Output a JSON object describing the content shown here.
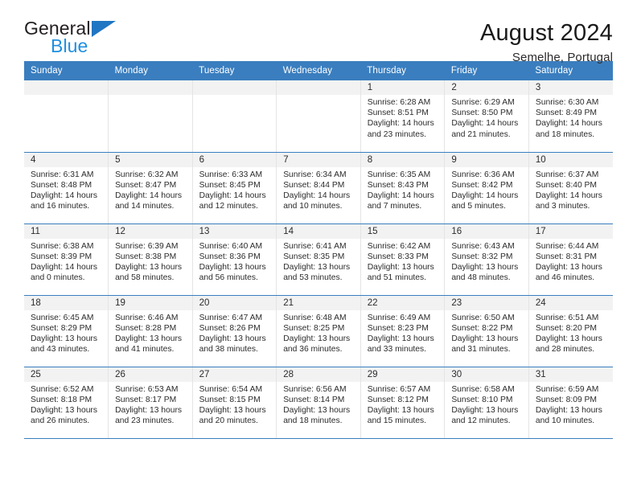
{
  "brand": {
    "name_part1": "General",
    "name_part2": "Blue",
    "accent_color": "#1f8fe0",
    "triangle_color": "#1f76c2"
  },
  "header": {
    "title": "August 2024",
    "subtitle": "Semelhe, Portugal"
  },
  "calendar": {
    "header_bg": "#3a7ebf",
    "daynum_bg": "#f2f2f2",
    "weekday_headers": [
      "Sunday",
      "Monday",
      "Tuesday",
      "Wednesday",
      "Thursday",
      "Friday",
      "Saturday"
    ],
    "weeks": [
      [
        {
          "day": "",
          "lines": []
        },
        {
          "day": "",
          "lines": []
        },
        {
          "day": "",
          "lines": []
        },
        {
          "day": "",
          "lines": []
        },
        {
          "day": "1",
          "lines": [
            "Sunrise: 6:28 AM",
            "Sunset: 8:51 PM",
            "Daylight: 14 hours",
            "and 23 minutes."
          ]
        },
        {
          "day": "2",
          "lines": [
            "Sunrise: 6:29 AM",
            "Sunset: 8:50 PM",
            "Daylight: 14 hours",
            "and 21 minutes."
          ]
        },
        {
          "day": "3",
          "lines": [
            "Sunrise: 6:30 AM",
            "Sunset: 8:49 PM",
            "Daylight: 14 hours",
            "and 18 minutes."
          ]
        }
      ],
      [
        {
          "day": "4",
          "lines": [
            "Sunrise: 6:31 AM",
            "Sunset: 8:48 PM",
            "Daylight: 14 hours",
            "and 16 minutes."
          ]
        },
        {
          "day": "5",
          "lines": [
            "Sunrise: 6:32 AM",
            "Sunset: 8:47 PM",
            "Daylight: 14 hours",
            "and 14 minutes."
          ]
        },
        {
          "day": "6",
          "lines": [
            "Sunrise: 6:33 AM",
            "Sunset: 8:45 PM",
            "Daylight: 14 hours",
            "and 12 minutes."
          ]
        },
        {
          "day": "7",
          "lines": [
            "Sunrise: 6:34 AM",
            "Sunset: 8:44 PM",
            "Daylight: 14 hours",
            "and 10 minutes."
          ]
        },
        {
          "day": "8",
          "lines": [
            "Sunrise: 6:35 AM",
            "Sunset: 8:43 PM",
            "Daylight: 14 hours",
            "and 7 minutes."
          ]
        },
        {
          "day": "9",
          "lines": [
            "Sunrise: 6:36 AM",
            "Sunset: 8:42 PM",
            "Daylight: 14 hours",
            "and 5 minutes."
          ]
        },
        {
          "day": "10",
          "lines": [
            "Sunrise: 6:37 AM",
            "Sunset: 8:40 PM",
            "Daylight: 14 hours",
            "and 3 minutes."
          ]
        }
      ],
      [
        {
          "day": "11",
          "lines": [
            "Sunrise: 6:38 AM",
            "Sunset: 8:39 PM",
            "Daylight: 14 hours",
            "and 0 minutes."
          ]
        },
        {
          "day": "12",
          "lines": [
            "Sunrise: 6:39 AM",
            "Sunset: 8:38 PM",
            "Daylight: 13 hours",
            "and 58 minutes."
          ]
        },
        {
          "day": "13",
          "lines": [
            "Sunrise: 6:40 AM",
            "Sunset: 8:36 PM",
            "Daylight: 13 hours",
            "and 56 minutes."
          ]
        },
        {
          "day": "14",
          "lines": [
            "Sunrise: 6:41 AM",
            "Sunset: 8:35 PM",
            "Daylight: 13 hours",
            "and 53 minutes."
          ]
        },
        {
          "day": "15",
          "lines": [
            "Sunrise: 6:42 AM",
            "Sunset: 8:33 PM",
            "Daylight: 13 hours",
            "and 51 minutes."
          ]
        },
        {
          "day": "16",
          "lines": [
            "Sunrise: 6:43 AM",
            "Sunset: 8:32 PM",
            "Daylight: 13 hours",
            "and 48 minutes."
          ]
        },
        {
          "day": "17",
          "lines": [
            "Sunrise: 6:44 AM",
            "Sunset: 8:31 PM",
            "Daylight: 13 hours",
            "and 46 minutes."
          ]
        }
      ],
      [
        {
          "day": "18",
          "lines": [
            "Sunrise: 6:45 AM",
            "Sunset: 8:29 PM",
            "Daylight: 13 hours",
            "and 43 minutes."
          ]
        },
        {
          "day": "19",
          "lines": [
            "Sunrise: 6:46 AM",
            "Sunset: 8:28 PM",
            "Daylight: 13 hours",
            "and 41 minutes."
          ]
        },
        {
          "day": "20",
          "lines": [
            "Sunrise: 6:47 AM",
            "Sunset: 8:26 PM",
            "Daylight: 13 hours",
            "and 38 minutes."
          ]
        },
        {
          "day": "21",
          "lines": [
            "Sunrise: 6:48 AM",
            "Sunset: 8:25 PM",
            "Daylight: 13 hours",
            "and 36 minutes."
          ]
        },
        {
          "day": "22",
          "lines": [
            "Sunrise: 6:49 AM",
            "Sunset: 8:23 PM",
            "Daylight: 13 hours",
            "and 33 minutes."
          ]
        },
        {
          "day": "23",
          "lines": [
            "Sunrise: 6:50 AM",
            "Sunset: 8:22 PM",
            "Daylight: 13 hours",
            "and 31 minutes."
          ]
        },
        {
          "day": "24",
          "lines": [
            "Sunrise: 6:51 AM",
            "Sunset: 8:20 PM",
            "Daylight: 13 hours",
            "and 28 minutes."
          ]
        }
      ],
      [
        {
          "day": "25",
          "lines": [
            "Sunrise: 6:52 AM",
            "Sunset: 8:18 PM",
            "Daylight: 13 hours",
            "and 26 minutes."
          ]
        },
        {
          "day": "26",
          "lines": [
            "Sunrise: 6:53 AM",
            "Sunset: 8:17 PM",
            "Daylight: 13 hours",
            "and 23 minutes."
          ]
        },
        {
          "day": "27",
          "lines": [
            "Sunrise: 6:54 AM",
            "Sunset: 8:15 PM",
            "Daylight: 13 hours",
            "and 20 minutes."
          ]
        },
        {
          "day": "28",
          "lines": [
            "Sunrise: 6:56 AM",
            "Sunset: 8:14 PM",
            "Daylight: 13 hours",
            "and 18 minutes."
          ]
        },
        {
          "day": "29",
          "lines": [
            "Sunrise: 6:57 AM",
            "Sunset: 8:12 PM",
            "Daylight: 13 hours",
            "and 15 minutes."
          ]
        },
        {
          "day": "30",
          "lines": [
            "Sunrise: 6:58 AM",
            "Sunset: 8:10 PM",
            "Daylight: 13 hours",
            "and 12 minutes."
          ]
        },
        {
          "day": "31",
          "lines": [
            "Sunrise: 6:59 AM",
            "Sunset: 8:09 PM",
            "Daylight: 13 hours",
            "and 10 minutes."
          ]
        }
      ]
    ]
  }
}
